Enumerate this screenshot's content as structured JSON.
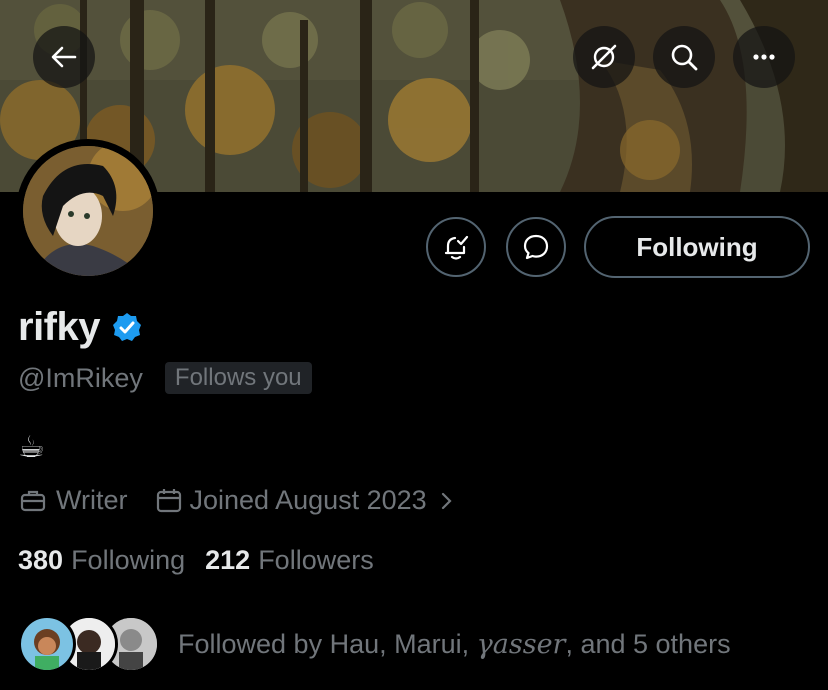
{
  "banner": {
    "description_icons": [
      "back-arrow-icon",
      "grok-icon",
      "search-icon",
      "more-icon"
    ]
  },
  "profile": {
    "name": "rifky",
    "handle": "@ImRikey",
    "follows_you": "Follows you",
    "bio": "☕",
    "profession": "Writer",
    "joined": "Joined August 2023",
    "following_count": "380",
    "following_label": "Following",
    "followers_count": "212",
    "followers_label": "Followers"
  },
  "actions": {
    "following_button": "Following"
  },
  "followed_by": {
    "prefix": "Followed by Hau, Marui, ",
    "name3": "𝛾asser",
    "suffix": ", and 5 others"
  },
  "colors": {
    "verified": "#1d9bf0",
    "muted": "#71767b",
    "text": "#e7e9ea",
    "border": "#536471"
  }
}
